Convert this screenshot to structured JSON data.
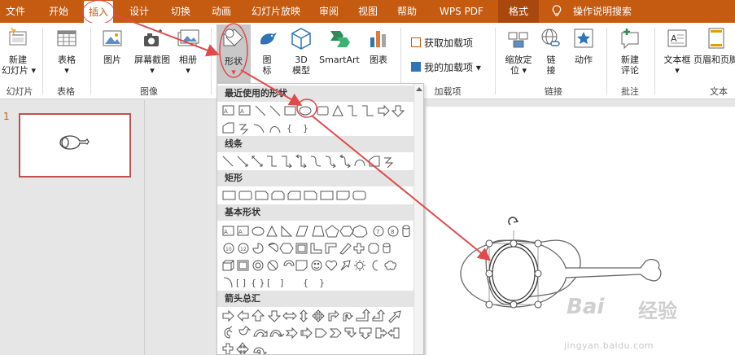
{
  "tabs": [
    {
      "label": "文件"
    },
    {
      "label": "开始"
    },
    {
      "label": "插入"
    },
    {
      "label": "设计"
    },
    {
      "label": "切换"
    },
    {
      "label": "动画"
    },
    {
      "label": "幻灯片放映"
    },
    {
      "label": "审阅"
    },
    {
      "label": "视图"
    },
    {
      "label": "帮助"
    },
    {
      "label": "WPS PDF"
    },
    {
      "label": "格式"
    }
  ],
  "tell_me": "操作说明搜索",
  "ribbon": {
    "new_slide": {
      "line1": "新建",
      "line2": "幻灯片 ▾"
    },
    "table": {
      "label": "表格",
      "arrow": "▾"
    },
    "picture": {
      "label": "图片"
    },
    "screenshot": {
      "label": "屏幕截图",
      "arrow": "▾"
    },
    "album": {
      "label": "相册",
      "arrow": "▾"
    },
    "shapes": {
      "label": "形状",
      "arrow": "▾"
    },
    "icons": {
      "line1": "图",
      "line2": "标"
    },
    "model3d": {
      "line1": "3D",
      "line2": "模型"
    },
    "smartart": {
      "label": "SmartArt"
    },
    "chart": {
      "label": "图表"
    },
    "get_addins": {
      "label": "获取加载项"
    },
    "my_addins": {
      "label": "我的加载项",
      "arrow": "▾"
    },
    "zoom": {
      "line1": "缩放定",
      "line2": "位 ▾"
    },
    "link": {
      "line1": "链",
      "line2": "接"
    },
    "action": {
      "label": "动作"
    },
    "comment": {
      "line1": "新建",
      "line2": "评论"
    },
    "textbox": {
      "label": "文本框",
      "arrow": "▾"
    },
    "header_footer": {
      "label": "页眉和页脚"
    },
    "groups": {
      "slides": "幻灯片",
      "tables": "表格",
      "images": "图像",
      "addins": "加载项",
      "links": "链接",
      "comments": "批注",
      "text": "文本"
    }
  },
  "dropdown": {
    "sections": {
      "recent": "最近使用的形状",
      "lines": "线条",
      "rectangles": "矩形",
      "basic": "基本形状",
      "arrows": "箭头总汇"
    }
  },
  "slides_panel": {
    "number": "1"
  },
  "watermark": {
    "brand": "Bai",
    "brand2": "经验",
    "url": "jingyan.baidu.com"
  },
  "colors": {
    "accent": "#c55a11",
    "annotation": "#e04a4a"
  }
}
